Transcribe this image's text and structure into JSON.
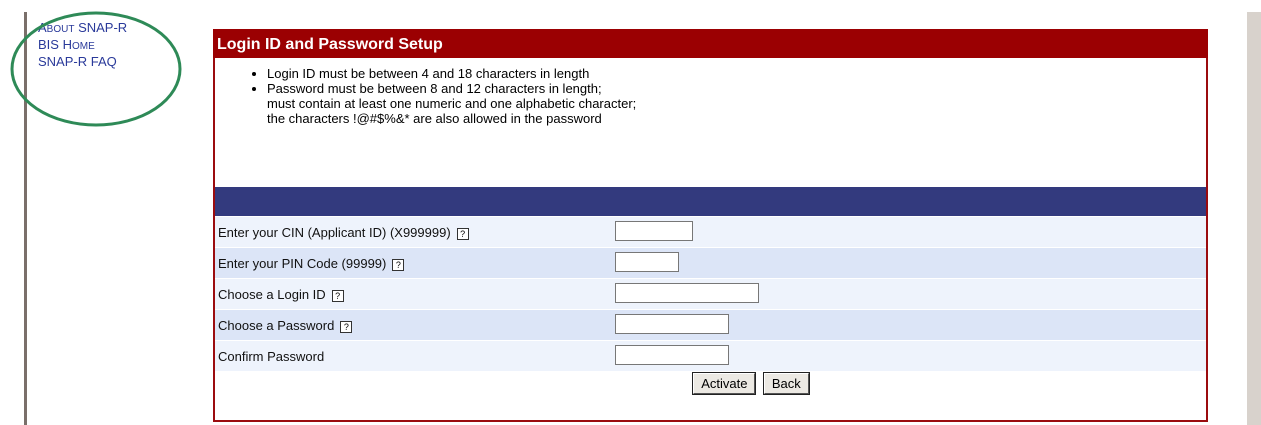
{
  "nav": {
    "about_first": "A",
    "about_rest": "bout",
    "about_suffix": "SNAP-R",
    "bis_first": "BIS H",
    "bis_rest": "ome",
    "faq": "SNAP-R FAQ"
  },
  "panel": {
    "title": "Login ID and Password Setup",
    "rules": [
      "Login ID must be between 4 and 18 characters in length",
      "Password must be between 8 and 12 characters in length;",
      "must contain at least one numeric and one alphabetic character;",
      "the characters !@#$%&* are also allowed in the password"
    ]
  },
  "form": {
    "help_glyph": "?",
    "cin_label": "Enter your CIN (Applicant ID) (X999999)",
    "cin_value": "",
    "pin_label": "Enter your PIN Code (99999)",
    "pin_value": "",
    "login_label": "Choose a Login ID",
    "login_value": "",
    "password_label": "Choose a Password",
    "password_value": "",
    "confirm_label": "Confirm Password",
    "confirm_value": ""
  },
  "buttons": {
    "activate": "Activate",
    "back": "Back"
  },
  "colors": {
    "title_bar": "#9b0002",
    "band": "#333a7e",
    "row_alt": "#dce5f7",
    "annotation_circle": "#2e8a57"
  }
}
